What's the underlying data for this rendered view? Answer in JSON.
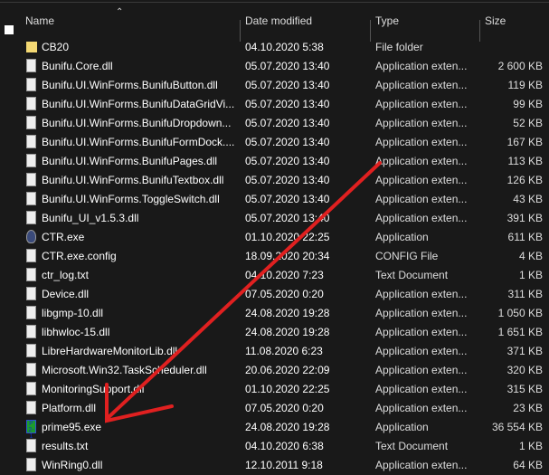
{
  "columns": {
    "name": "Name",
    "date": "Date modified",
    "type": "Type",
    "size": "Size"
  },
  "files": [
    {
      "icon": "folder",
      "name": "CB20",
      "date": "04.10.2020 5:38",
      "type": "File folder",
      "size": ""
    },
    {
      "icon": "dll",
      "name": "Bunifu.Core.dll",
      "date": "05.07.2020 13:40",
      "type": "Application exten...",
      "size": "2 600 KB"
    },
    {
      "icon": "dll",
      "name": "Bunifu.UI.WinForms.BunifuButton.dll",
      "date": "05.07.2020 13:40",
      "type": "Application exten...",
      "size": "119 KB"
    },
    {
      "icon": "dll",
      "name": "Bunifu.UI.WinForms.BunifuDataGridVi...",
      "date": "05.07.2020 13:40",
      "type": "Application exten...",
      "size": "99 KB"
    },
    {
      "icon": "dll",
      "name": "Bunifu.UI.WinForms.BunifuDropdown...",
      "date": "05.07.2020 13:40",
      "type": "Application exten...",
      "size": "52 KB"
    },
    {
      "icon": "dll",
      "name": "Bunifu.UI.WinForms.BunifuFormDock....",
      "date": "05.07.2020 13:40",
      "type": "Application exten...",
      "size": "167 KB"
    },
    {
      "icon": "dll",
      "name": "Bunifu.UI.WinForms.BunifuPages.dll",
      "date": "05.07.2020 13:40",
      "type": "Application exten...",
      "size": "113 KB"
    },
    {
      "icon": "dll",
      "name": "Bunifu.UI.WinForms.BunifuTextbox.dll",
      "date": "05.07.2020 13:40",
      "type": "Application exten...",
      "size": "126 KB"
    },
    {
      "icon": "dll",
      "name": "Bunifu.UI.WinForms.ToggleSwitch.dll",
      "date": "05.07.2020 13:40",
      "type": "Application exten...",
      "size": "43 KB"
    },
    {
      "icon": "dll",
      "name": "Bunifu_UI_v1.5.3.dll",
      "date": "05.07.2020 13:40",
      "type": "Application exten...",
      "size": "391 KB"
    },
    {
      "icon": "exe",
      "name": "CTR.exe",
      "date": "01.10.2020 22:25",
      "type": "Application",
      "size": "611 KB"
    },
    {
      "icon": "file",
      "name": "CTR.exe.config",
      "date": "18.09.2020 20:34",
      "type": "CONFIG File",
      "size": "4 KB"
    },
    {
      "icon": "txt",
      "name": "ctr_log.txt",
      "date": "04.10.2020 7:23",
      "type": "Text Document",
      "size": "1 KB"
    },
    {
      "icon": "dll",
      "name": "Device.dll",
      "date": "07.05.2020 0:20",
      "type": "Application exten...",
      "size": "311 KB"
    },
    {
      "icon": "dll",
      "name": "libgmp-10.dll",
      "date": "24.08.2020 19:28",
      "type": "Application exten...",
      "size": "1 050 KB"
    },
    {
      "icon": "dll",
      "name": "libhwloc-15.dll",
      "date": "24.08.2020 19:28",
      "type": "Application exten...",
      "size": "1 651 KB"
    },
    {
      "icon": "dll",
      "name": "LibreHardwareMonitorLib.dll",
      "date": "11.08.2020 6:23",
      "type": "Application exten...",
      "size": "371 KB"
    },
    {
      "icon": "dll",
      "name": "Microsoft.Win32.TaskScheduler.dll",
      "date": "20.06.2020 22:09",
      "type": "Application exten...",
      "size": "320 KB"
    },
    {
      "icon": "dll",
      "name": "MonitoringSupport.dll",
      "date": "01.10.2020 22:25",
      "type": "Application exten...",
      "size": "315 KB"
    },
    {
      "icon": "dll",
      "name": "Platform.dll",
      "date": "07.05.2020 0:20",
      "type": "Application exten...",
      "size": "23 KB"
    },
    {
      "icon": "prime",
      "name": "prime95.exe",
      "date": "24.08.2020 19:28",
      "type": "Application",
      "size": "36 554 KB"
    },
    {
      "icon": "txt",
      "name": "results.txt",
      "date": "04.10.2020 6:38",
      "type": "Text Document",
      "size": "1 KB"
    },
    {
      "icon": "dll",
      "name": "WinRing0.dll",
      "date": "12.10.2011 9:18",
      "type": "Application exten...",
      "size": "64 KB"
    }
  ],
  "annotation_color": "#e02020"
}
